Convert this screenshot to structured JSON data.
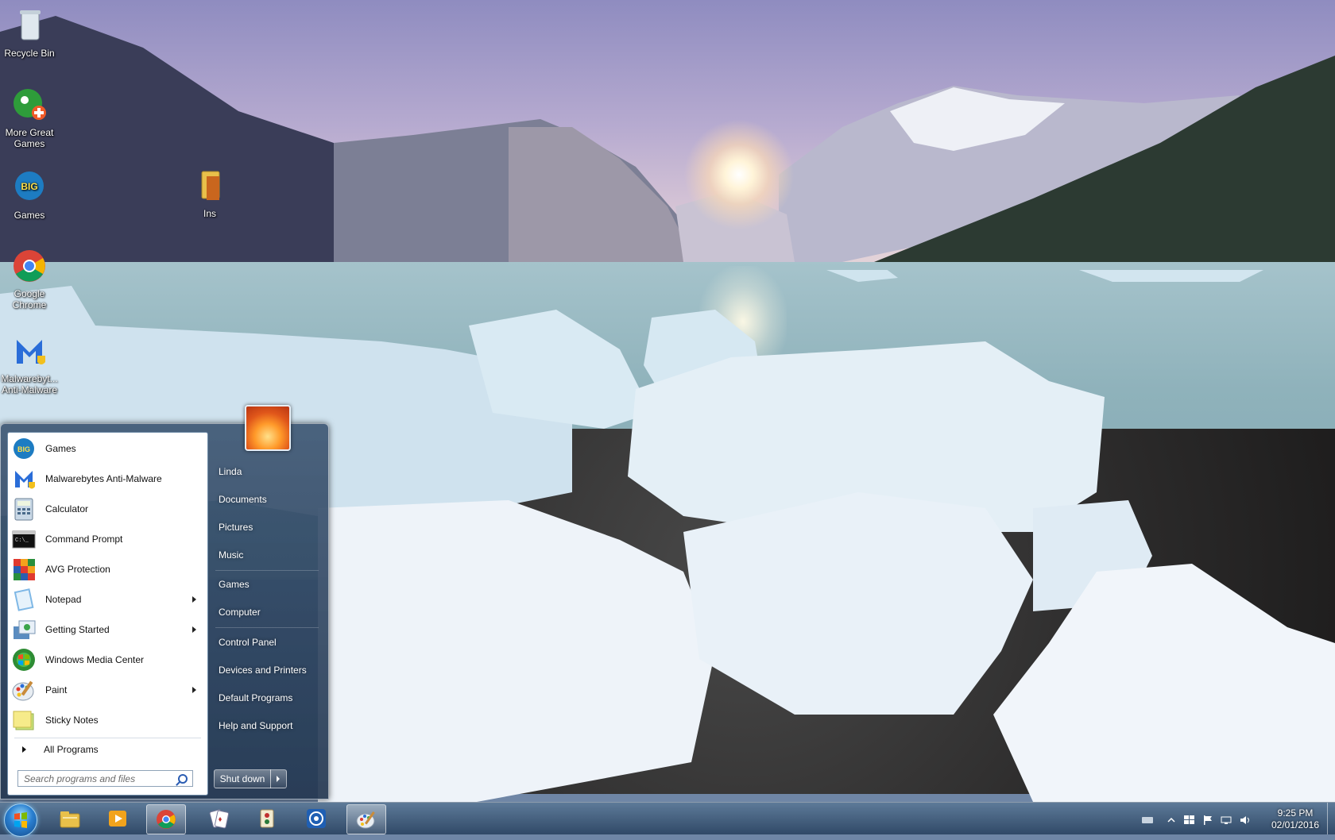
{
  "desktop": {
    "icons": [
      {
        "label": "Recycle Bin",
        "icon": "recycle-bin-icon"
      },
      {
        "label": "More Great Games",
        "icon": "game-shortcut-icon"
      },
      {
        "label": "Games",
        "icon": "big-fish-games-icon"
      },
      {
        "label": "Google Chrome",
        "icon": "chrome-icon"
      },
      {
        "label": "Malwarebyt... Anti-Malware",
        "icon": "malwarebytes-icon"
      },
      {
        "label": "Ins",
        "icon": "folder-icon"
      }
    ]
  },
  "start_menu": {
    "programs": [
      {
        "label": "Games",
        "icon": "big-fish-games-icon",
        "submenu": false
      },
      {
        "label": "Malwarebytes Anti-Malware",
        "icon": "malwarebytes-icon",
        "submenu": false
      },
      {
        "label": "Calculator",
        "icon": "calculator-icon",
        "submenu": false
      },
      {
        "label": "Command Prompt",
        "icon": "command-prompt-icon",
        "submenu": false
      },
      {
        "label": "AVG Protection",
        "icon": "avg-icon",
        "submenu": false
      },
      {
        "label": "Notepad",
        "icon": "notepad-icon",
        "submenu": true
      },
      {
        "label": "Getting Started",
        "icon": "getting-started-icon",
        "submenu": true
      },
      {
        "label": "Windows Media Center",
        "icon": "media-center-icon",
        "submenu": false
      },
      {
        "label": "Paint",
        "icon": "paint-icon",
        "submenu": true
      },
      {
        "label": "Sticky Notes",
        "icon": "sticky-notes-icon",
        "submenu": false
      }
    ],
    "all_programs": "All Programs",
    "search_placeholder": "Search programs and files",
    "places": [
      {
        "label": "Linda"
      },
      {
        "label": "Documents"
      },
      {
        "label": "Pictures"
      },
      {
        "label": "Music"
      },
      {
        "label": "Games"
      },
      {
        "label": "Computer"
      },
      {
        "label": "Control Panel"
      },
      {
        "label": "Devices and Printers"
      },
      {
        "label": "Default Programs"
      },
      {
        "label": "Help and Support"
      }
    ],
    "shutdown_label": "Shut down"
  },
  "taskbar": {
    "pinned": [
      {
        "icon": "windows-explorer-icon",
        "active": false
      },
      {
        "icon": "media-player-icon",
        "active": false
      },
      {
        "icon": "chrome-icon",
        "active": true
      },
      {
        "icon": "solitaire-icon",
        "active": false
      },
      {
        "icon": "mahjong-icon",
        "active": false
      },
      {
        "icon": "malwarebytes-scan-icon",
        "active": false
      },
      {
        "icon": "paint-icon",
        "active": true
      }
    ],
    "tray_icons": [
      "keyboard-icon",
      "show-hidden-icons-chevron",
      "windows-flag-icon",
      "action-center-flag-icon",
      "network-icon",
      "volume-icon"
    ],
    "clock": {
      "time": "9:25 PM",
      "date": "02/01/2016"
    }
  },
  "colors": {
    "start_menu_bg": "#2d4662",
    "taskbar_bg": "#3b5a7c",
    "accent": "#2a7fd0"
  }
}
